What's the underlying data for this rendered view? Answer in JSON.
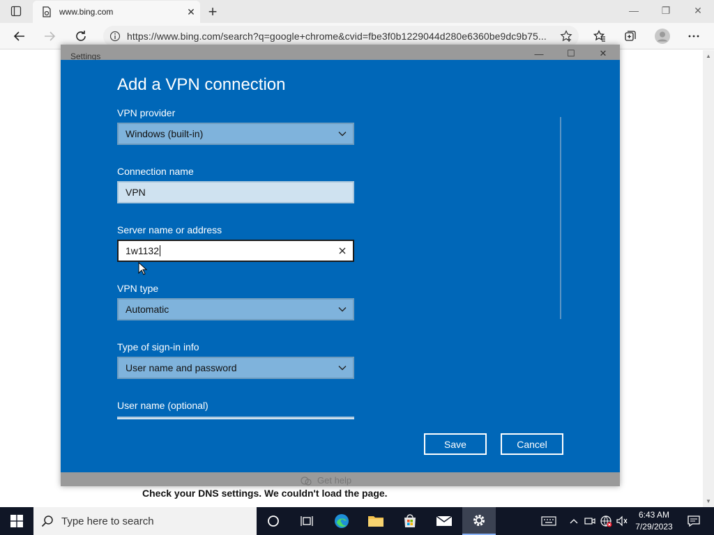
{
  "browser": {
    "tab_title": "www.bing.com",
    "url": "https://www.bing.com/search?q=google+chrome&cvid=fbe3f0b1229044d280e6360be9dc9b75..."
  },
  "page": {
    "dns_message": "Check your DNS settings. We couldn't load the page.",
    "get_help": "Get help"
  },
  "settings_window": {
    "title": "Settings"
  },
  "vpn_dialog": {
    "heading": "Add a VPN connection",
    "provider_label": "VPN provider",
    "provider_value": "Windows (built-in)",
    "connection_name_label": "Connection name",
    "connection_name_value": "VPN",
    "server_label": "Server name or address",
    "server_value": "1w1132",
    "vpn_type_label": "VPN type",
    "vpn_type_value": "Automatic",
    "signin_label": "Type of sign-in info",
    "signin_value": "User name and password",
    "username_label": "User name (optional)",
    "save_label": "Save",
    "cancel_label": "Cancel"
  },
  "taskbar": {
    "search_placeholder": "Type here to search",
    "time": "6:43 AM",
    "date": "7/29/2023"
  },
  "colors": {
    "settings_accent": "#0067b8",
    "taskbar": "#101626"
  }
}
